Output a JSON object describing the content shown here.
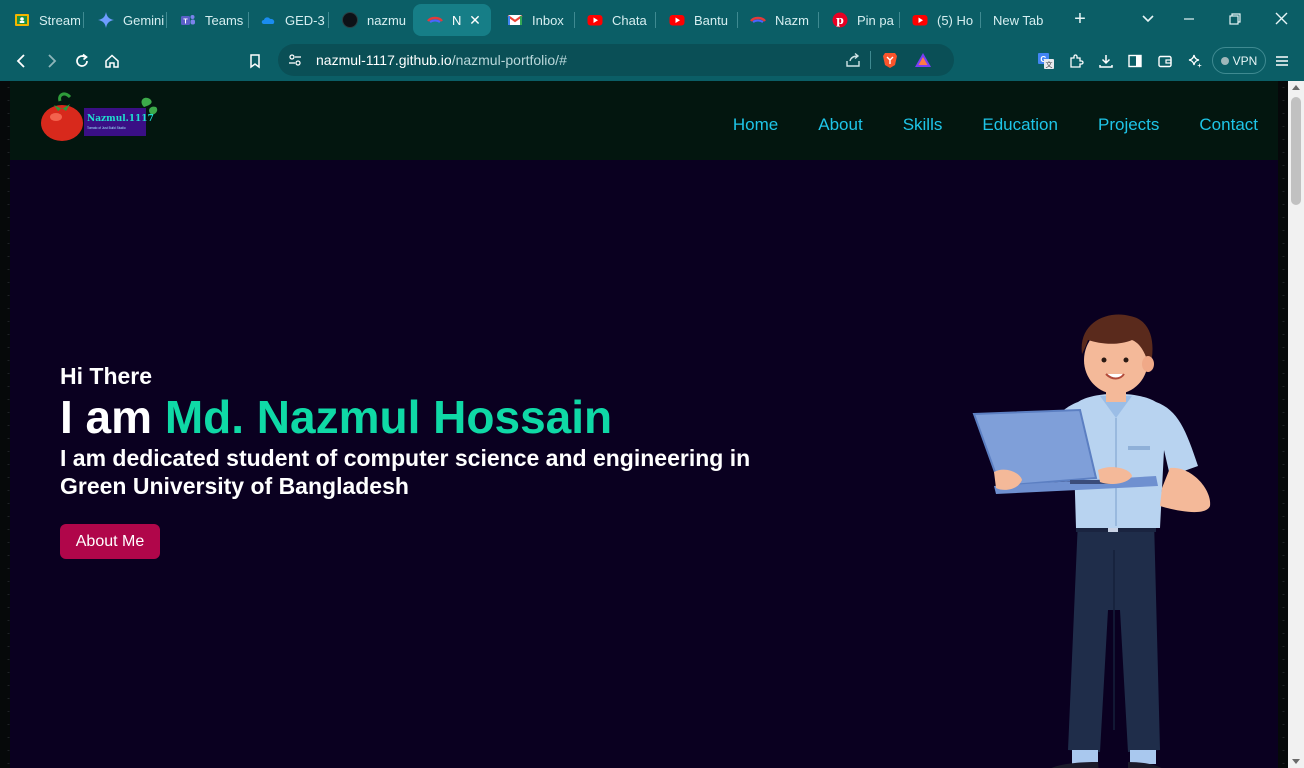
{
  "browser": {
    "tabs": [
      {
        "title": "Stream",
        "icon": "classroom-icon",
        "active": false
      },
      {
        "title": "Gemini",
        "icon": "gemini-icon",
        "active": false
      },
      {
        "title": "Teams",
        "icon": "teams-icon",
        "active": false
      },
      {
        "title": "GED-3",
        "icon": "onedrive-icon",
        "active": false
      },
      {
        "title": "nazmu",
        "icon": "github-icon",
        "active": false
      },
      {
        "title": "N",
        "icon": "site-icon",
        "active": true
      },
      {
        "title": "Inbox",
        "icon": "gmail-icon",
        "active": false
      },
      {
        "title": "Chata",
        "icon": "youtube-icon",
        "active": false
      },
      {
        "title": "Bantu",
        "icon": "youtube-icon",
        "active": false
      },
      {
        "title": "Nazm",
        "icon": "site-icon",
        "active": false
      },
      {
        "title": "Pin pa",
        "icon": "pinterest-icon",
        "active": false
      },
      {
        "title": "(5) Ho",
        "icon": "youtube-icon",
        "active": false
      },
      {
        "title": "New Tab",
        "icon": "",
        "active": false
      }
    ],
    "url": {
      "host": "nazmul-1117.github.io",
      "path": "/nazmul-portfolio/#"
    },
    "vpn_label": "VPN"
  },
  "site": {
    "logo": {
      "text": "Nazmul.1117",
      "subtext": "Tomato of Just Build Studio"
    },
    "nav": [
      "Home",
      "About",
      "Skills",
      "Education",
      "Projects",
      "Contact"
    ],
    "hero": {
      "greeting": "Hi There",
      "headline_prefix": "I am ",
      "headline_name": "Md. Nazmul Hossain",
      "tagline": "I am dedicated student of computer science and engineering in Green University of Bangladesh",
      "button_label": "About Me"
    }
  },
  "colors": {
    "browser_chrome": "#0b5e66",
    "header_bg": "#03160f",
    "hero_bg": "#0a0020",
    "nav_link": "#1ec5e8",
    "name_accent": "#0fd9a6",
    "button_bg": "#b0064a"
  }
}
